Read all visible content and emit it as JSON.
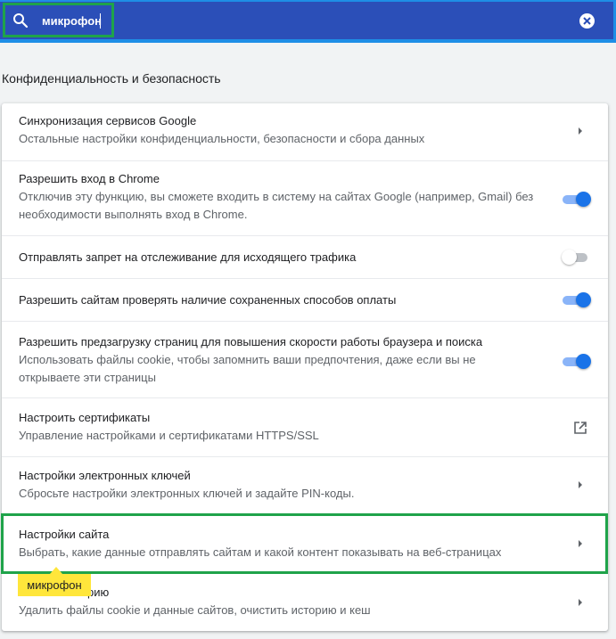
{
  "search": {
    "value": "микрофон"
  },
  "section": {
    "title": "Конфиденциальность и безопасность"
  },
  "rows": [
    {
      "title": "Синхронизация сервисов Google",
      "subtitle": "Остальные настройки конфиденциальности, безопасности и сбора данных",
      "control": "arrow"
    },
    {
      "title": "Разрешить вход в Chrome",
      "subtitle_line1": "Отключив эту функцию, вы сможете входить в систему на сайтах Google (например, Gmail) без",
      "subtitle_line2": "необходимости выполнять вход в Chrome.",
      "control": "toggle",
      "enabled": true
    },
    {
      "title": "Отправлять запрет на отслеживание для исходящего трафика",
      "control": "toggle",
      "enabled": false
    },
    {
      "title": "Разрешить сайтам проверять наличие сохраненных способов оплаты",
      "control": "toggle",
      "enabled": true
    },
    {
      "title": "Разрешить предзагрузку страниц для повышения скорости работы браузера и поиска",
      "subtitle_line1": "Использовать файлы cookie, чтобы запомнить ваши предпочтения, даже если вы не",
      "subtitle_line2": "открываете эти страницы",
      "control": "toggle",
      "enabled": true
    },
    {
      "title": "Настроить сертификаты",
      "subtitle": "Управление настройками и сертификатами HTTPS/SSL",
      "control": "external-link"
    },
    {
      "title": "Настройки электронных ключей",
      "subtitle": "Сбросьте настройки электронных ключей и задайте PIN-коды.",
      "control": "arrow"
    },
    {
      "title": "Настройки сайта",
      "subtitle": "Выбрать, какие данные отправлять сайтам и какой контент показывать на веб-страницах",
      "control": "arrow"
    },
    {
      "title_visible": "рию",
      "subtitle": "Удалить файлы cookie и данные сайтов, очистить историю и кеш",
      "control": "arrow"
    }
  ],
  "tooltip": {
    "text": "микрофон"
  },
  "colors": {
    "header": "#2b4fb8",
    "toggle_on": "#1a73e8",
    "highlight": "#1fa34a",
    "tooltip": "#ffe63b"
  },
  "icons": {
    "search": "search-icon",
    "clear": "close-circle-icon",
    "arrow": "chevron-right-icon",
    "external": "open-in-new-icon"
  }
}
